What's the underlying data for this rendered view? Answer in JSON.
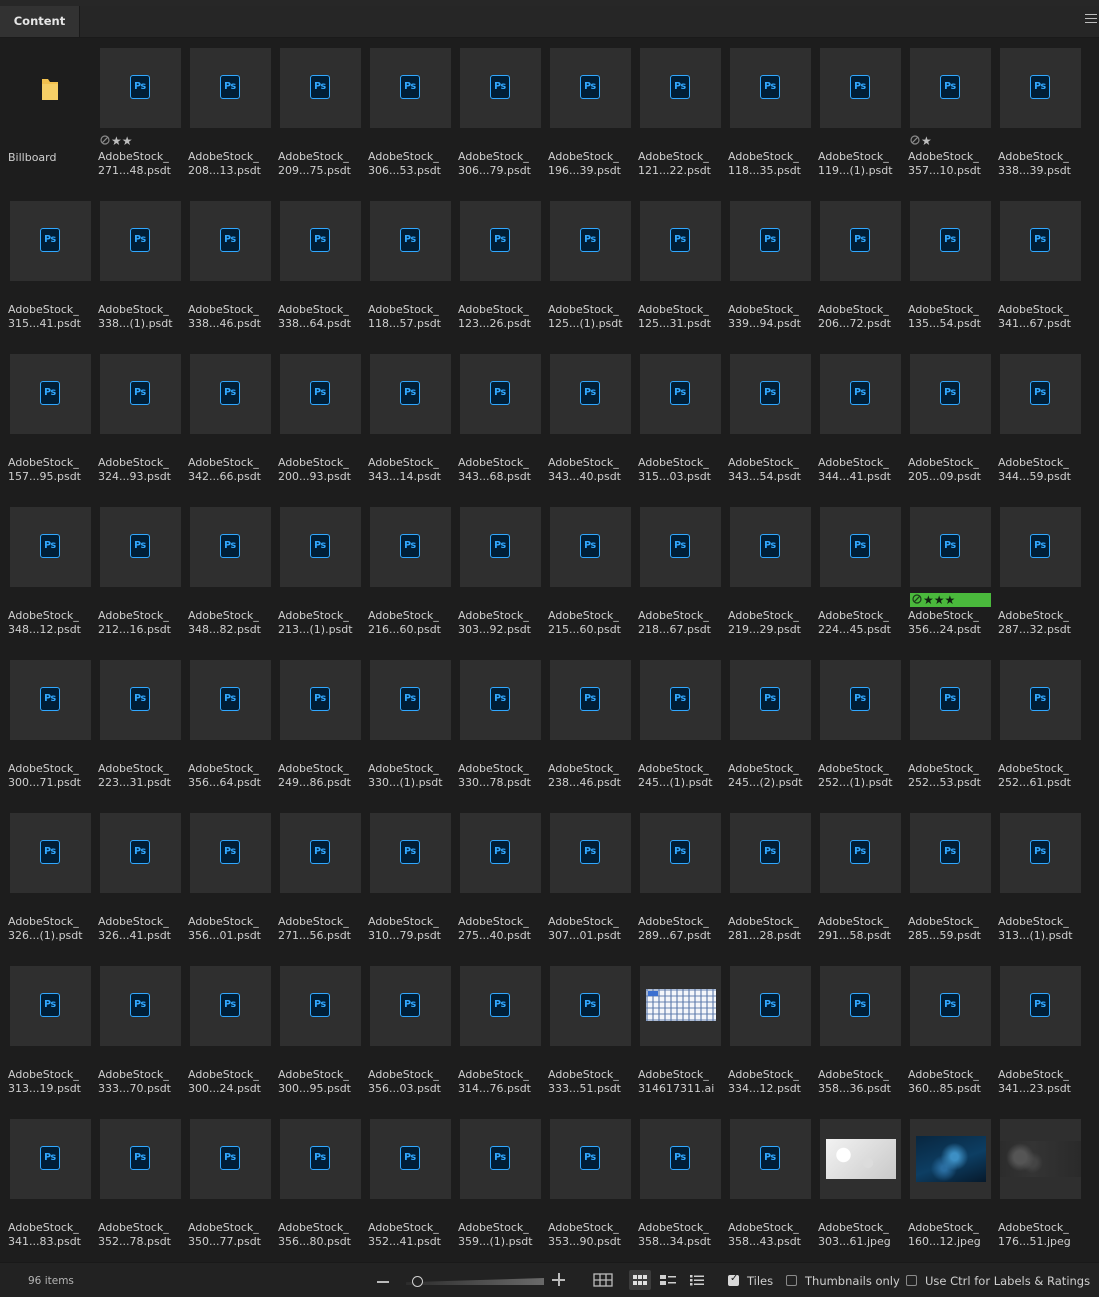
{
  "panel": {
    "tab_label": "Content"
  },
  "items": [
    {
      "name": "Billboard",
      "type": "folder"
    },
    {
      "name": "AdobeStock_\n271...48.psdt",
      "type": "psd",
      "rating": 2,
      "reject": true
    },
    {
      "name": "AdobeStock_\n208...13.psdt",
      "type": "psd"
    },
    {
      "name": "AdobeStock_\n209...75.psdt",
      "type": "psd"
    },
    {
      "name": "AdobeStock_\n306...53.psdt",
      "type": "psd"
    },
    {
      "name": "AdobeStock_\n306...79.psdt",
      "type": "psd"
    },
    {
      "name": "AdobeStock_\n196...39.psdt",
      "type": "psd"
    },
    {
      "name": "AdobeStock_\n121...22.psdt",
      "type": "psd"
    },
    {
      "name": "AdobeStock_\n118...35.psdt",
      "type": "psd"
    },
    {
      "name": "AdobeStock_\n119...(1).psdt",
      "type": "psd"
    },
    {
      "name": "AdobeStock_\n357...10.psdt",
      "type": "psd",
      "rating": 1,
      "reject": true
    },
    {
      "name": "AdobeStock_\n338...39.psdt",
      "type": "psd"
    },
    {
      "name": "AdobeStock_\n315...41.psdt",
      "type": "psd"
    },
    {
      "name": "AdobeStock_\n338...(1).psdt",
      "type": "psd"
    },
    {
      "name": "AdobeStock_\n338...46.psdt",
      "type": "psd"
    },
    {
      "name": "AdobeStock_\n338...64.psdt",
      "type": "psd"
    },
    {
      "name": "AdobeStock_\n118...57.psdt",
      "type": "psd"
    },
    {
      "name": "AdobeStock_\n123...26.psdt",
      "type": "psd"
    },
    {
      "name": "AdobeStock_\n125...(1).psdt",
      "type": "psd"
    },
    {
      "name": "AdobeStock_\n125...31.psdt",
      "type": "psd"
    },
    {
      "name": "AdobeStock_\n339...94.psdt",
      "type": "psd"
    },
    {
      "name": "AdobeStock_\n206...72.psdt",
      "type": "psd"
    },
    {
      "name": "AdobeStock_\n135...54.psdt",
      "type": "psd"
    },
    {
      "name": "AdobeStock_\n341...67.psdt",
      "type": "psd"
    },
    {
      "name": "AdobeStock_\n157...95.psdt",
      "type": "psd"
    },
    {
      "name": "AdobeStock_\n324...93.psdt",
      "type": "psd"
    },
    {
      "name": "AdobeStock_\n342...66.psdt",
      "type": "psd"
    },
    {
      "name": "AdobeStock_\n200...93.psdt",
      "type": "psd"
    },
    {
      "name": "AdobeStock_\n343...14.psdt",
      "type": "psd"
    },
    {
      "name": "AdobeStock_\n343...68.psdt",
      "type": "psd"
    },
    {
      "name": "AdobeStock_\n343...40.psdt",
      "type": "psd"
    },
    {
      "name": "AdobeStock_\n315...03.psdt",
      "type": "psd"
    },
    {
      "name": "AdobeStock_\n343...54.psdt",
      "type": "psd"
    },
    {
      "name": "AdobeStock_\n344...41.psdt",
      "type": "psd"
    },
    {
      "name": "AdobeStock_\n205...09.psdt",
      "type": "psd"
    },
    {
      "name": "AdobeStock_\n344...59.psdt",
      "type": "psd"
    },
    {
      "name": "AdobeStock_\n348...12.psdt",
      "type": "psd"
    },
    {
      "name": "AdobeStock_\n212...16.psdt",
      "type": "psd"
    },
    {
      "name": "AdobeStock_\n348...82.psdt",
      "type": "psd"
    },
    {
      "name": "AdobeStock_\n213...(1).psdt",
      "type": "psd"
    },
    {
      "name": "AdobeStock_\n216...60.psdt",
      "type": "psd"
    },
    {
      "name": "AdobeStock_\n303...92.psdt",
      "type": "psd"
    },
    {
      "name": "AdobeStock_\n215...60.psdt",
      "type": "psd"
    },
    {
      "name": "AdobeStock_\n218...67.psdt",
      "type": "psd"
    },
    {
      "name": "AdobeStock_\n219...29.psdt",
      "type": "psd"
    },
    {
      "name": "AdobeStock_\n224...45.psdt",
      "type": "psd"
    },
    {
      "name": "AdobeStock_\n356...24.psdt",
      "type": "psd",
      "rating": 3,
      "reject": true,
      "label_color": "#4ab93c"
    },
    {
      "name": "AdobeStock_\n287...32.psdt",
      "type": "psd"
    },
    {
      "name": "AdobeStock_\n300...71.psdt",
      "type": "psd"
    },
    {
      "name": "AdobeStock_\n223...31.psdt",
      "type": "psd"
    },
    {
      "name": "AdobeStock_\n356...64.psdt",
      "type": "psd"
    },
    {
      "name": "AdobeStock_\n249...86.psdt",
      "type": "psd"
    },
    {
      "name": "AdobeStock_\n330...(1).psdt",
      "type": "psd"
    },
    {
      "name": "AdobeStock_\n330...78.psdt",
      "type": "psd"
    },
    {
      "name": "AdobeStock_\n238...46.psdt",
      "type": "psd"
    },
    {
      "name": "AdobeStock_\n245...(1).psdt",
      "type": "psd"
    },
    {
      "name": "AdobeStock_\n245...(2).psdt",
      "type": "psd"
    },
    {
      "name": "AdobeStock_\n252...(1).psdt",
      "type": "psd"
    },
    {
      "name": "AdobeStock_\n252...53.psdt",
      "type": "psd"
    },
    {
      "name": "AdobeStock_\n252...61.psdt",
      "type": "psd"
    },
    {
      "name": "AdobeStock_\n326...(1).psdt",
      "type": "psd"
    },
    {
      "name": "AdobeStock_\n326...41.psdt",
      "type": "psd"
    },
    {
      "name": "AdobeStock_\n356...01.psdt",
      "type": "psd"
    },
    {
      "name": "AdobeStock_\n271...56.psdt",
      "type": "psd"
    },
    {
      "name": "AdobeStock_\n310...79.psdt",
      "type": "psd"
    },
    {
      "name": "AdobeStock_\n275...40.psdt",
      "type": "psd"
    },
    {
      "name": "AdobeStock_\n307...01.psdt",
      "type": "psd"
    },
    {
      "name": "AdobeStock_\n289...67.psdt",
      "type": "psd"
    },
    {
      "name": "AdobeStock_\n281...28.psdt",
      "type": "psd"
    },
    {
      "name": "AdobeStock_\n291...58.psdt",
      "type": "psd"
    },
    {
      "name": "AdobeStock_\n285...59.psdt",
      "type": "psd"
    },
    {
      "name": "AdobeStock_\n313...(1).psdt",
      "type": "psd"
    },
    {
      "name": "AdobeStock_\n313...19.psdt",
      "type": "psd"
    },
    {
      "name": "AdobeStock_\n333...70.psdt",
      "type": "psd"
    },
    {
      "name": "AdobeStock_\n300...24.psdt",
      "type": "psd"
    },
    {
      "name": "AdobeStock_\n300...95.psdt",
      "type": "psd"
    },
    {
      "name": "AdobeStock_\n356...03.psdt",
      "type": "psd"
    },
    {
      "name": "AdobeStock_\n314...76.psdt",
      "type": "psd"
    },
    {
      "name": "AdobeStock_\n333...51.psdt",
      "type": "psd"
    },
    {
      "name": "AdobeStock_\n314617311.ai",
      "type": "ai-image"
    },
    {
      "name": "AdobeStock_\n334...12.psdt",
      "type": "psd"
    },
    {
      "name": "AdobeStock_\n358...36.psdt",
      "type": "psd"
    },
    {
      "name": "AdobeStock_\n360...85.psdt",
      "type": "psd"
    },
    {
      "name": "AdobeStock_\n341...23.psdt",
      "type": "psd"
    },
    {
      "name": "AdobeStock_\n341...83.psdt",
      "type": "psd"
    },
    {
      "name": "AdobeStock_\n352...78.psdt",
      "type": "psd"
    },
    {
      "name": "AdobeStock_\n350...77.psdt",
      "type": "psd"
    },
    {
      "name": "AdobeStock_\n356...80.psdt",
      "type": "psd"
    },
    {
      "name": "AdobeStock_\n352...41.psdt",
      "type": "psd"
    },
    {
      "name": "AdobeStock_\n359...(1).psdt",
      "type": "psd"
    },
    {
      "name": "AdobeStock_\n353...90.psdt",
      "type": "psd"
    },
    {
      "name": "AdobeStock_\n358...34.psdt",
      "type": "psd"
    },
    {
      "name": "AdobeStock_\n358...43.psdt",
      "type": "psd"
    },
    {
      "name": "AdobeStock_\n303...61.jpeg",
      "type": "white-image"
    },
    {
      "name": "AdobeStock_\n160...12.jpeg",
      "type": "blue-image"
    },
    {
      "name": "AdobeStock_\n176...51.jpeg",
      "type": "dark-image"
    }
  ],
  "ps_icon_text": "Ps",
  "icons": {
    "folder": "folder-icon",
    "photoshop": "photoshop-file-icon",
    "reject": "reject-icon",
    "star": "star-icon"
  },
  "status": {
    "item_count": "96 items",
    "zoom_level": 0.05,
    "tiles_label": "Tiles",
    "tiles_checked": true,
    "thumbs_label": "Thumbnails only",
    "thumbs_checked": false,
    "ctrl_label": "Use Ctrl for Labels & Ratings",
    "ctrl_checked": false
  },
  "colors": {
    "accent_ps": "#31a8ff",
    "label_green": "#4ab93c",
    "folder": "#f2c14e"
  }
}
